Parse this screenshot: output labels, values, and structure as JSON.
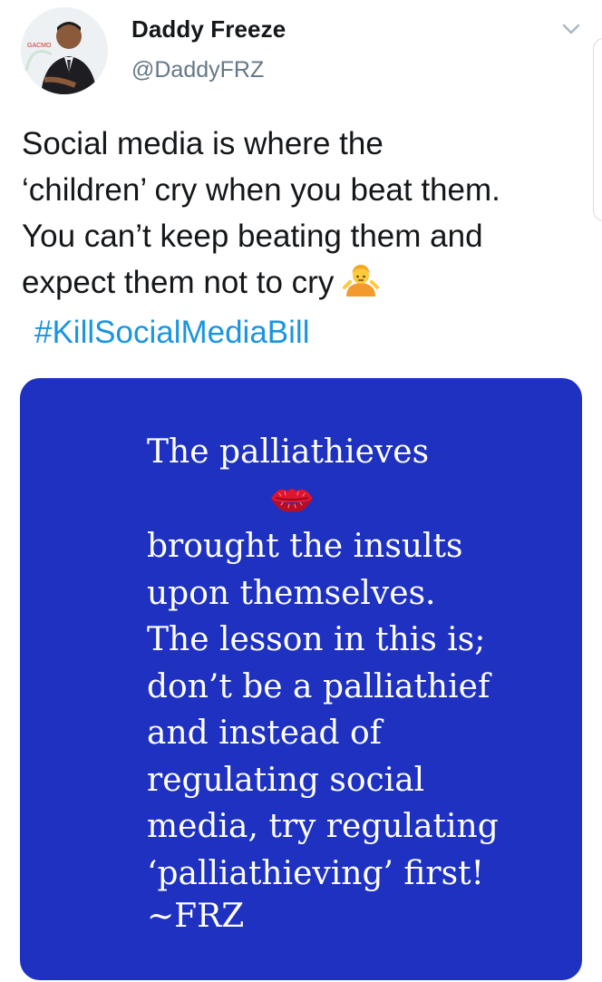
{
  "author": {
    "display_name": "Daddy Freeze",
    "handle": "@DaddyFRZ",
    "avatar_badge": "GACMO"
  },
  "tweet": {
    "lines": [
      "Social media is where the",
      "‘children’ cry when you beat them.",
      "You can’t keep beating them and",
      "expect them not to cry"
    ],
    "emoji": "person-shrugging-emoji",
    "hashtag": "#KillSocialMediaBill"
  },
  "media": {
    "background_color": "#1e31c0",
    "text_color": "#ffffff",
    "first_line": "The palliathieves",
    "emoji": "kiss-mark-icon",
    "body_lines": [
      "brought the insults",
      "upon themselves.",
      "The lesson in this is;",
      "don’t be a palliathief",
      "and instead of",
      "regulating social",
      "media, try regulating",
      "‘palliathieving’ first!"
    ],
    "signature": "~FRZ"
  },
  "colors": {
    "link": "#1b95e0",
    "secondary_text": "#657786",
    "primary_text": "#14171a"
  },
  "icons": {
    "menu": "chevron-down-icon"
  }
}
